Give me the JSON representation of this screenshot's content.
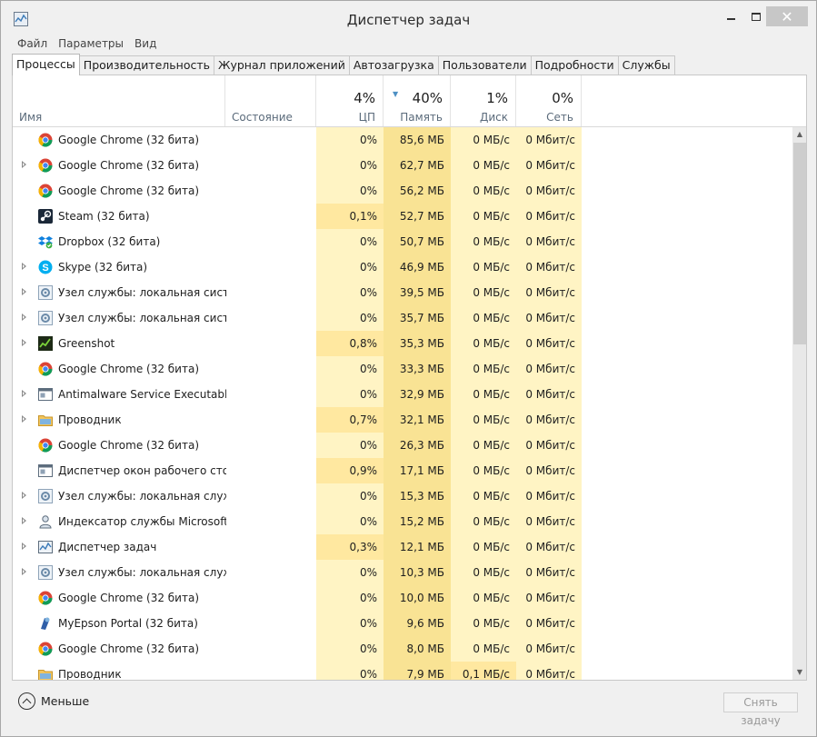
{
  "window": {
    "title": "Диспетчер задач",
    "close_glyph": "✕"
  },
  "menu": [
    "Файл",
    "Параметры",
    "Вид"
  ],
  "tabs": [
    {
      "label": "Процессы",
      "active": true
    },
    {
      "label": "Производительность",
      "active": false
    },
    {
      "label": "Журнал приложений",
      "active": false
    },
    {
      "label": "Автозагрузка",
      "active": false
    },
    {
      "label": "Пользователи",
      "active": false
    },
    {
      "label": "Подробности",
      "active": false
    },
    {
      "label": "Службы",
      "active": false
    }
  ],
  "columns": {
    "name": {
      "label": "Имя"
    },
    "status": {
      "label": "Состояние"
    },
    "cpu": {
      "label": "ЦП",
      "total": "4%"
    },
    "memory": {
      "label": "Память",
      "total": "40%"
    },
    "disk": {
      "label": "Диск",
      "total": "1%"
    },
    "network": {
      "label": "Сеть",
      "total": "0%"
    }
  },
  "colors": {
    "heat_light": "#fff4c4",
    "heat_medium": "#ffe8a0",
    "heat_strong": "#f9e394",
    "sort_arrow": "#4e90c4"
  },
  "processes": [
    {
      "name": "Google Chrome (32 бита)",
      "icon": "chrome-icon",
      "expandable": false,
      "cpu": "0%",
      "memory": "85,6 МБ",
      "disk": "0 МБ/с",
      "network": "0 Мбит/с"
    },
    {
      "name": "Google Chrome (32 бита)",
      "icon": "chrome-icon",
      "expandable": true,
      "cpu": "0%",
      "memory": "62,7 МБ",
      "disk": "0 МБ/с",
      "network": "0 Мбит/с"
    },
    {
      "name": "Google Chrome (32 бита)",
      "icon": "chrome-icon",
      "expandable": false,
      "cpu": "0%",
      "memory": "56,2 МБ",
      "disk": "0 МБ/с",
      "network": "0 Мбит/с"
    },
    {
      "name": "Steam (32 бита)",
      "icon": "steam-icon",
      "expandable": false,
      "cpu": "0,1%",
      "memory": "52,7 МБ",
      "disk": "0 МБ/с",
      "network": "0 Мбит/с"
    },
    {
      "name": "Dropbox (32 бита)",
      "icon": "dropbox-icon",
      "expandable": false,
      "cpu": "0%",
      "memory": "50,7 МБ",
      "disk": "0 МБ/с",
      "network": "0 Мбит/с"
    },
    {
      "name": "Skype (32 бита)",
      "icon": "skype-icon",
      "expandable": true,
      "cpu": "0%",
      "memory": "46,9 МБ",
      "disk": "0 МБ/с",
      "network": "0 Мбит/с"
    },
    {
      "name": "Узел службы: локальная систе...",
      "icon": "service-host-icon",
      "expandable": true,
      "cpu": "0%",
      "memory": "39,5 МБ",
      "disk": "0 МБ/с",
      "network": "0 Мбит/с"
    },
    {
      "name": "Узел службы: локальная систе...",
      "icon": "service-host-icon",
      "expandable": true,
      "cpu": "0%",
      "memory": "35,7 МБ",
      "disk": "0 МБ/с",
      "network": "0 Мбит/с"
    },
    {
      "name": "Greenshot",
      "icon": "greenshot-icon",
      "expandable": true,
      "cpu": "0,8%",
      "memory": "35,3 МБ",
      "disk": "0 МБ/с",
      "network": "0 Мбит/с"
    },
    {
      "name": "Google Chrome (32 бита)",
      "icon": "chrome-icon",
      "expandable": false,
      "cpu": "0%",
      "memory": "33,3 МБ",
      "disk": "0 МБ/с",
      "network": "0 Мбит/с"
    },
    {
      "name": "Antimalware Service Executable",
      "icon": "app-window-icon",
      "expandable": true,
      "cpu": "0%",
      "memory": "32,9 МБ",
      "disk": "0 МБ/с",
      "network": "0 Мбит/с"
    },
    {
      "name": "Проводник",
      "icon": "explorer-folder-icon",
      "expandable": true,
      "cpu": "0,7%",
      "memory": "32,1 МБ",
      "disk": "0 МБ/с",
      "network": "0 Мбит/с"
    },
    {
      "name": "Google Chrome (32 бита)",
      "icon": "chrome-icon",
      "expandable": false,
      "cpu": "0%",
      "memory": "26,3 МБ",
      "disk": "0 МБ/с",
      "network": "0 Мбит/с"
    },
    {
      "name": "Диспетчер окон рабочего стола",
      "icon": "app-window-icon",
      "expandable": false,
      "cpu": "0,9%",
      "memory": "17,1 МБ",
      "disk": "0 МБ/с",
      "network": "0 Мбит/с"
    },
    {
      "name": "Узел службы: локальная служ...",
      "icon": "service-host-icon",
      "expandable": true,
      "cpu": "0%",
      "memory": "15,3 МБ",
      "disk": "0 МБ/с",
      "network": "0 Мбит/с"
    },
    {
      "name": "Индексатор службы Microsoft ...",
      "icon": "indexer-icon",
      "expandable": true,
      "cpu": "0%",
      "memory": "15,2 МБ",
      "disk": "0 МБ/с",
      "network": "0 Мбит/с"
    },
    {
      "name": "Диспетчер задач",
      "icon": "task-manager-icon",
      "expandable": true,
      "cpu": "0,3%",
      "memory": "12,1 МБ",
      "disk": "0 МБ/с",
      "network": "0 Мбит/с"
    },
    {
      "name": "Узел службы: локальная служ...",
      "icon": "service-host-icon",
      "expandable": true,
      "cpu": "0%",
      "memory": "10,3 МБ",
      "disk": "0 МБ/с",
      "network": "0 Мбит/с"
    },
    {
      "name": "Google Chrome (32 бита)",
      "icon": "chrome-icon",
      "expandable": false,
      "cpu": "0%",
      "memory": "10,0 МБ",
      "disk": "0 МБ/с",
      "network": "0 Мбит/с"
    },
    {
      "name": "MyEpson Portal (32 бита)",
      "icon": "epson-icon",
      "expandable": false,
      "cpu": "0%",
      "memory": "9,6 МБ",
      "disk": "0 МБ/с",
      "network": "0 Мбит/с"
    },
    {
      "name": "Google Chrome (32 бита)",
      "icon": "chrome-icon",
      "expandable": false,
      "cpu": "0%",
      "memory": "8,0 МБ",
      "disk": "0 МБ/с",
      "network": "0 Мбит/с"
    },
    {
      "name": "Проводник",
      "icon": "explorer-folder-icon",
      "expandable": false,
      "cpu": "0%",
      "memory": "7,9 МБ",
      "disk": "0,1 МБ/с",
      "network": "0 Мбит/с"
    }
  ],
  "footer": {
    "fewer_label": "Меньше",
    "end_task_label": "Снять задачу"
  }
}
